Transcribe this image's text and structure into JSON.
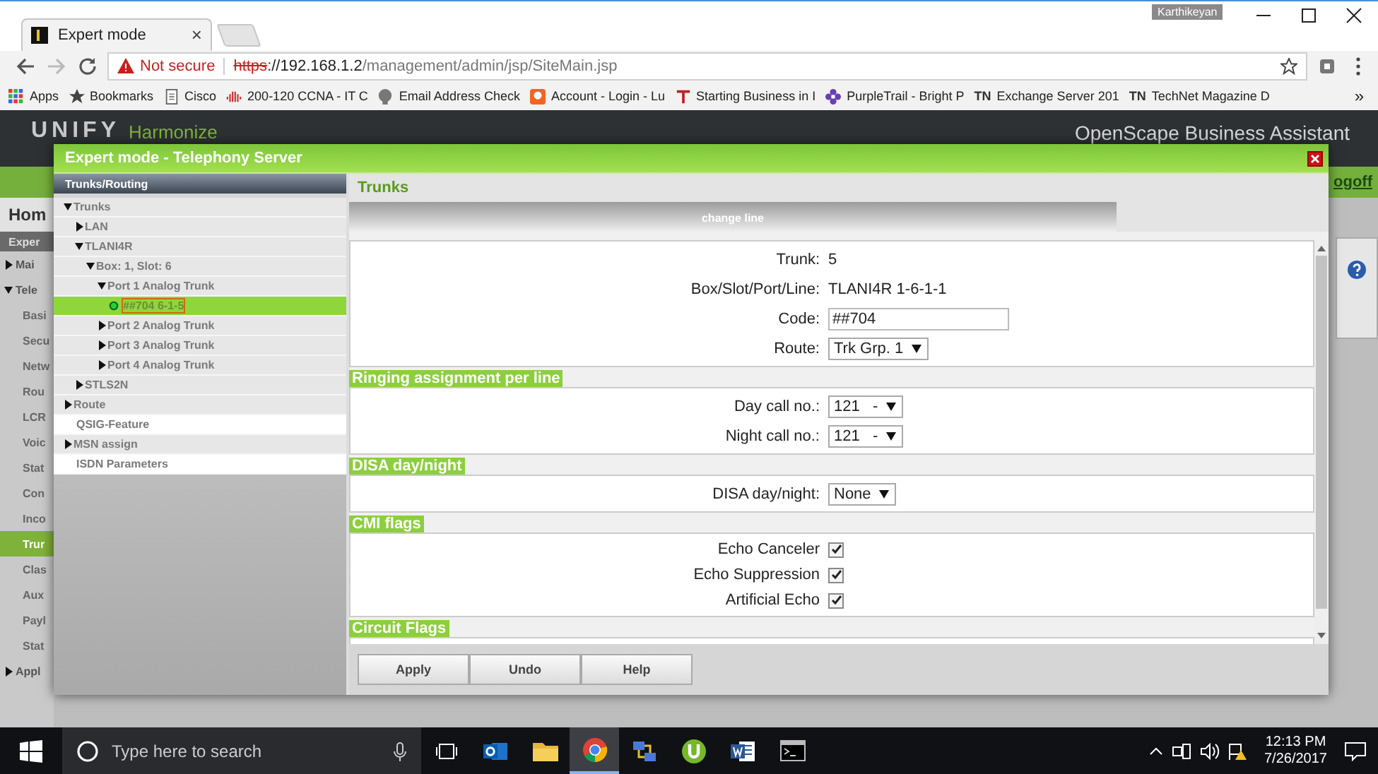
{
  "browser": {
    "tab": {
      "title": "Expert mode",
      "close": "×"
    },
    "user": "Karthikeyan",
    "address": {
      "security": "Not secure",
      "scheme": "https",
      "host": "://192.168.1.2",
      "path": "/management/admin/jsp/SiteMain.jsp"
    },
    "bookmarks": [
      {
        "label": "Apps",
        "kind": "apps"
      },
      {
        "label": "Bookmarks",
        "kind": "star"
      },
      {
        "label": "Cisco",
        "kind": "page"
      },
      {
        "label": "200-120 CCNA - IT C",
        "kind": "bars"
      },
      {
        "label": "Email Address Check",
        "kind": "blob"
      },
      {
        "label": "Account - Login - Lu",
        "kind": "orange"
      },
      {
        "label": "Starting Business in I",
        "kind": "pin"
      },
      {
        "label": "PurpleTrail - Bright P",
        "kind": "flower"
      },
      {
        "label": "Exchange Server 201",
        "kind": "badge",
        "badge": "TN"
      },
      {
        "label": "TechNet Magazine D",
        "kind": "badge",
        "badge": "TN"
      }
    ],
    "more": "»"
  },
  "app": {
    "logo": "UNIFY",
    "product": "Harmonize",
    "title": "OpenScape Business Assistant",
    "logoff": "ogoff",
    "home": "Hom",
    "nav_header": "Exper",
    "nav": [
      {
        "label": "Mai",
        "kind": "group",
        "expanded": false,
        "selected": false
      },
      {
        "label": "Tele",
        "kind": "group",
        "expanded": true,
        "selected": false
      },
      {
        "label": "Basi",
        "kind": "item",
        "selected": false
      },
      {
        "label": "Secu",
        "kind": "item",
        "selected": false
      },
      {
        "label": "Netw",
        "kind": "item",
        "selected": false
      },
      {
        "label": "Rou",
        "kind": "item",
        "selected": false
      },
      {
        "label": "LCR",
        "kind": "item",
        "selected": false
      },
      {
        "label": "Voic",
        "kind": "item",
        "selected": false
      },
      {
        "label": "Stat",
        "kind": "item",
        "selected": false
      },
      {
        "label": "Con",
        "kind": "item",
        "selected": false
      },
      {
        "label": "Inco",
        "kind": "item",
        "selected": false
      },
      {
        "label": "Trur",
        "kind": "item",
        "selected": true
      },
      {
        "label": "Clas",
        "kind": "item",
        "selected": false
      },
      {
        "label": "Aux",
        "kind": "item",
        "selected": false
      },
      {
        "label": "Payl",
        "kind": "item",
        "selected": false
      },
      {
        "label": "Stat",
        "kind": "item",
        "selected": false
      },
      {
        "label": "Appl",
        "kind": "group",
        "expanded": false,
        "selected": false
      }
    ]
  },
  "modal": {
    "title": "Expert mode - Telephony Server",
    "tree_title": "Trunks/Routing",
    "tree": [
      {
        "label": "Trunks",
        "expanded": true,
        "selected": false,
        "children": [
          {
            "label": "LAN",
            "expanded": false,
            "selected": false
          },
          {
            "label": "TLANI4R",
            "expanded": true,
            "selected": false,
            "children": [
              {
                "label": "Box: 1, Slot: 6",
                "expanded": true,
                "selected": false,
                "children": [
                  {
                    "label": "Port 1 Analog Trunk",
                    "expanded": true,
                    "selected": false,
                    "children": [
                      {
                        "label": "##704 6-1-5",
                        "selected": true
                      }
                    ]
                  },
                  {
                    "label": "Port 2 Analog Trunk",
                    "expanded": false,
                    "selected": false
                  },
                  {
                    "label": "Port 3 Analog Trunk",
                    "expanded": false,
                    "selected": false
                  },
                  {
                    "label": "Port 4 Analog Trunk",
                    "expanded": false,
                    "selected": false
                  }
                ]
              }
            ]
          },
          {
            "label": "STLS2N",
            "expanded": false,
            "selected": false
          }
        ]
      },
      {
        "label": "Route",
        "expanded": false,
        "selected": false
      },
      {
        "label": "QSIG-Feature",
        "selected": false
      },
      {
        "label": "MSN assign",
        "expanded": false,
        "selected": false
      },
      {
        "label": "ISDN Parameters",
        "selected": false
      }
    ],
    "heading": "Trunks",
    "tabs": [
      {
        "label": "change line",
        "selected": true
      }
    ],
    "fields": [
      {
        "kind": "text",
        "label": "Trunk:",
        "value": "5"
      },
      {
        "kind": "text",
        "label": "Box/Slot/Port/Line:",
        "value": "TLANI4R 1-6-1-1"
      },
      {
        "kind": "input",
        "label": "Code:",
        "value": "##704"
      },
      {
        "kind": "select",
        "label": "Route:",
        "value": "Trk Grp. 1"
      }
    ],
    "sections": [
      {
        "title": "Ringing assignment per line",
        "fields": [
          {
            "kind": "select",
            "label": "Day call no.:",
            "value": "121   -"
          },
          {
            "kind": "select",
            "label": "Night call no.:",
            "value": "121   -"
          }
        ]
      },
      {
        "title": "DISA day/night",
        "fields": [
          {
            "kind": "select",
            "label": "DISA day/night:",
            "value": "None"
          }
        ]
      },
      {
        "title": "CMI flags",
        "fields": [
          {
            "kind": "checkbox",
            "label": "Echo Canceler",
            "checked": true
          },
          {
            "kind": "checkbox",
            "label": "Echo Suppression",
            "checked": true
          },
          {
            "kind": "checkbox",
            "label": "Artificial Echo",
            "checked": true
          }
        ]
      },
      {
        "title": "Circuit Flags"
      }
    ],
    "buttons": [
      "Apply",
      "Undo",
      "Help"
    ]
  },
  "taskbar": {
    "search": "Type here to search",
    "time": "12:13 PM",
    "date": "7/26/2017",
    "apps": [
      {
        "kind": "taskview",
        "selected": false
      },
      {
        "kind": "mail",
        "selected": false
      },
      {
        "kind": "folder",
        "selected": false
      },
      {
        "kind": "browser",
        "selected": true
      },
      {
        "kind": "network",
        "selected": false
      },
      {
        "kind": "torrent",
        "selected": false
      },
      {
        "kind": "word",
        "selected": false
      },
      {
        "kind": "terminal",
        "selected": false
      }
    ]
  }
}
